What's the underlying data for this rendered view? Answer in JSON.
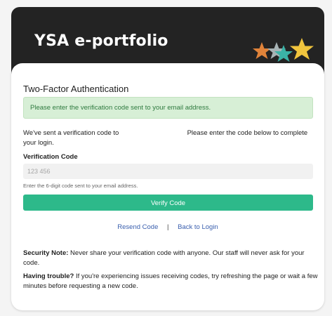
{
  "header": {
    "app_title": "YSA e-portfolio",
    "logo_icon": "ysa-stars-logo-icon",
    "colors": {
      "header_bg": "#232323",
      "star_orange": "#e0833a",
      "star_gray": "#a7b3b5",
      "star_teal": "#3bb3a7",
      "star_yellow": "#f0c43d"
    }
  },
  "card": {
    "title": "Two-Factor Authentication",
    "alert": {
      "message": "Please enter the verification code sent to your email address.",
      "bg_color": "#d7efd6",
      "text_color": "#2f7a3f"
    },
    "intro": {
      "before": "We've sent a verification code to",
      "after": "Please enter the code below to complete your login."
    },
    "field": {
      "label": "Verification Code",
      "placeholder": "123 456",
      "value": "",
      "hint": "Enter the 6-digit code sent to your email address."
    },
    "verify_button": {
      "label": "Verify Code",
      "color": "#2db98a"
    },
    "links": {
      "resend": "Resend Code",
      "separator": "|",
      "back": "Back to Login",
      "color": "#3a5fae"
    },
    "security_note": {
      "heading": "Security Note:",
      "text": "Never share your verification code with anyone. Our staff will never ask for your code."
    },
    "trouble_note": {
      "heading": "Having trouble?",
      "text": "If you're experiencing issues receiving codes, try refreshing the page or wait a few minutes before requesting a new code."
    }
  }
}
